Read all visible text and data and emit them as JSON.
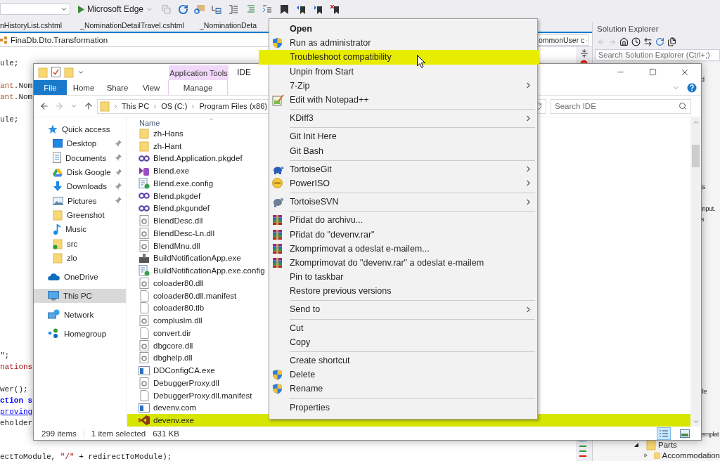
{
  "ide": {
    "toolbar": {
      "run_target": "Microsoft Edge"
    },
    "document_tabs": [
      "nHistoryList.cshtml",
      "_NominationDetailTravel.cshtml",
      "_NominationDeta"
    ],
    "nav_bar": {
      "type_path": "FinaDb.Dto.Transformation",
      "member": "ommonUser c"
    },
    "code_lines": [
      {
        "kind": "code",
        "tokens": [
          {
            "text": "ule;",
            "kind": "plain"
          }
        ]
      },
      {
        "kind": "blank"
      },
      {
        "kind": "code",
        "tokens": [
          {
            "text": "ant",
            "kind": "identifier"
          },
          {
            "text": ".Nom",
            "kind": "plain"
          }
        ]
      },
      {
        "kind": "code",
        "tokens": [
          {
            "text": "ant",
            "kind": "identifier"
          },
          {
            "text": ".Nom",
            "kind": "plain"
          }
        ]
      },
      {
        "kind": "blank"
      },
      {
        "kind": "code",
        "tokens": [
          {
            "text": "ule;",
            "kind": "plain"
          }
        ]
      },
      {
        "kind": "blank"
      },
      {
        "kind": "blank"
      },
      {
        "kind": "blank"
      },
      {
        "kind": "blank"
      },
      {
        "kind": "blank"
      },
      {
        "kind": "blank"
      },
      {
        "kind": "blank"
      },
      {
        "kind": "blank"
      },
      {
        "kind": "blank"
      },
      {
        "kind": "blank"
      },
      {
        "kind": "blank"
      },
      {
        "kind": "blank"
      },
      {
        "kind": "blank"
      },
      {
        "kind": "blank"
      },
      {
        "kind": "blank"
      },
      {
        "kind": "blank"
      },
      {
        "kind": "blank"
      },
      {
        "kind": "blank"
      },
      {
        "kind": "blank"
      },
      {
        "kind": "blank"
      },
      {
        "kind": "code",
        "tokens": [
          {
            "text": "\";",
            "kind": "plain"
          }
        ]
      },
      {
        "kind": "code",
        "tokens": [
          {
            "text": "nations",
            "kind": "string"
          }
        ]
      },
      {
        "kind": "blank"
      },
      {
        "kind": "code",
        "tokens": [
          {
            "text": "wer();",
            "kind": "plain"
          }
        ]
      },
      {
        "kind": "code",
        "tokens": [
          {
            "text": "ction s",
            "kind": "keyword"
          }
        ]
      },
      {
        "kind": "code",
        "tokens": [
          {
            "text": "proving",
            "kind": "link"
          }
        ]
      },
      {
        "kind": "code",
        "tokens": [
          {
            "text": "eholder",
            "kind": "plain"
          }
        ]
      },
      {
        "kind": "blank"
      },
      {
        "kind": "blank"
      },
      {
        "kind": "code",
        "tokens": [
          {
            "text": "ectToModule, ",
            "kind": "plain"
          },
          {
            "text": "\"/\"",
            "kind": "string"
          },
          {
            "text": " + redirectToModule);",
            "kind": "plain"
          }
        ]
      }
    ]
  },
  "solution_explorer": {
    "title": "Solution Explorer",
    "search": {
      "placeholder": "Search Solution Explorer (Ctrl+;)"
    },
    "rows": [
      {
        "kind": "fragment",
        "text": "d"
      },
      {
        "kind": "blank"
      },
      {
        "kind": "blank"
      },
      {
        "kind": "blank"
      },
      {
        "kind": "blank"
      },
      {
        "kind": "blank"
      },
      {
        "kind": "blank"
      },
      {
        "kind": "blank"
      },
      {
        "kind": "blank"
      },
      {
        "kind": "blank"
      },
      {
        "kind": "fragment",
        "text": "js"
      },
      {
        "kind": "blank"
      },
      {
        "kind": "fragment",
        "text": "input."
      },
      {
        "kind": "fragment",
        "text": "s"
      },
      {
        "kind": "blank"
      },
      {
        "kind": "blank"
      },
      {
        "kind": "blank"
      },
      {
        "kind": "blank"
      },
      {
        "kind": "blank"
      },
      {
        "kind": "blank"
      },
      {
        "kind": "blank"
      },
      {
        "kind": "blank"
      },
      {
        "kind": "blank"
      },
      {
        "kind": "blank"
      },
      {
        "kind": "blank"
      },
      {
        "kind": "blank"
      },
      {
        "kind": "blank"
      },
      {
        "kind": "blank"
      },
      {
        "kind": "blank"
      },
      {
        "kind": "fragment",
        "text": "ile"
      },
      {
        "kind": "blank"
      },
      {
        "kind": "blank"
      },
      {
        "kind": "blank"
      },
      {
        "kind": "fragment",
        "text": "emplat"
      },
      {
        "kind": "folder",
        "text": "Parts",
        "expanded": true,
        "children": [
          {
            "kind": "folder",
            "text": "Accommodation",
            "expanded": false
          }
        ]
      }
    ]
  },
  "explorer": {
    "context_tab_group": "Application Tools",
    "title": "IDE",
    "ribbon_tabs": [
      {
        "label": "File",
        "kind": "file"
      },
      {
        "label": "Home",
        "kind": "tab"
      },
      {
        "label": "Share",
        "kind": "tab"
      },
      {
        "label": "View",
        "kind": "tab"
      },
      {
        "label": "Manage",
        "kind": "context"
      }
    ],
    "address": [
      "This PC",
      "OS (C:)",
      "Program Files (x86)"
    ],
    "search": {
      "placeholder": "Search IDE"
    },
    "nav": [
      {
        "label": "Quick access",
        "kind": "quick-access",
        "selected": false,
        "children": [
          {
            "label": "Desktop",
            "kind": "desktop",
            "pinned": true,
            "selected": false
          },
          {
            "label": "Documents",
            "kind": "documents",
            "pinned": true,
            "selected": false
          },
          {
            "label": "Disk Google",
            "kind": "drive",
            "pinned": true,
            "selected": false
          },
          {
            "label": "Downloads",
            "kind": "downloads",
            "pinned": true,
            "selected": false
          },
          {
            "label": "Pictures",
            "kind": "pictures",
            "pinned": true,
            "selected": false
          },
          {
            "label": "Greenshot",
            "kind": "folder",
            "pinned": false,
            "selected": false
          },
          {
            "label": "Music",
            "kind": "music",
            "pinned": false,
            "selected": false
          },
          {
            "label": "src",
            "kind": "synced-folder",
            "pinned": false,
            "selected": false
          },
          {
            "label": "zlo",
            "kind": "folder",
            "pinned": false,
            "selected": false
          }
        ]
      },
      {
        "label": "OneDrive",
        "kind": "cloud",
        "selected": false
      },
      {
        "label": "This PC",
        "kind": "pc",
        "selected": true
      },
      {
        "label": "Network",
        "kind": "network",
        "selected": false
      },
      {
        "label": "Homegroup",
        "kind": "homegroup",
        "selected": false
      }
    ],
    "columns": [
      "Name"
    ],
    "files": [
      {
        "name": "zh-Hans",
        "kind": "folder",
        "selected": false
      },
      {
        "name": "zh-Hant",
        "kind": "folder",
        "selected": false
      },
      {
        "name": "Blend.Application.pkgdef",
        "kind": "package",
        "selected": false
      },
      {
        "name": "Blend.exe",
        "kind": "blend",
        "selected": false
      },
      {
        "name": "Blend.exe.config",
        "kind": "config",
        "selected": false
      },
      {
        "name": "Blend.pkgdef",
        "kind": "package",
        "selected": false
      },
      {
        "name": "Blend.pkgundef",
        "kind": "package",
        "selected": false
      },
      {
        "name": "BlendDesc.dll",
        "kind": "library",
        "selected": false
      },
      {
        "name": "BlendDesc-Ln.dll",
        "kind": "library",
        "selected": false
      },
      {
        "name": "BlendMnu.dll",
        "kind": "library",
        "selected": false
      },
      {
        "name": "BuildNotificationApp.exe",
        "kind": "build-app",
        "selected": false
      },
      {
        "name": "BuildNotificationApp.exe.config",
        "kind": "config",
        "selected": false
      },
      {
        "name": "coloader80.dll",
        "kind": "library",
        "selected": false
      },
      {
        "name": "coloader80.dll.manifest",
        "kind": "document",
        "selected": false
      },
      {
        "name": "coloader80.tlb",
        "kind": "document",
        "selected": false
      },
      {
        "name": "compluslm.dll",
        "kind": "library",
        "selected": false
      },
      {
        "name": "convert.dir",
        "kind": "document",
        "selected": false
      },
      {
        "name": "dbgcore.dll",
        "kind": "library",
        "selected": false
      },
      {
        "name": "dbghelp.dll",
        "kind": "library",
        "selected": false
      },
      {
        "name": "DDConfigCA.exe",
        "kind": "window-app",
        "selected": false
      },
      {
        "name": "DebuggerProxy.dll",
        "kind": "library",
        "selected": false
      },
      {
        "name": "DebuggerProxy.dll.manifest",
        "kind": "document",
        "selected": false
      },
      {
        "name": "devenv.com",
        "kind": "window-app",
        "selected": false
      },
      {
        "name": "devenv.exe",
        "kind": "vs-app",
        "selected": true
      }
    ],
    "status": {
      "count": "299 items",
      "selection": "1 item selected",
      "size": "631 KB"
    },
    "views": [
      {
        "kind": "details",
        "selected": true
      },
      {
        "kind": "tiles",
        "selected": false
      }
    ]
  },
  "context_menu": {
    "groups": [
      {
        "items": [
          {
            "label": "Open",
            "kind": "plain",
            "default": true,
            "submenu": false,
            "selected": false
          },
          {
            "label": "Run as administrator",
            "kind": "shield",
            "default": false,
            "submenu": false,
            "selected": false
          },
          {
            "label": "Troubleshoot compatibility",
            "kind": "plain",
            "default": false,
            "submenu": false,
            "selected": true
          },
          {
            "label": "Unpin from Start",
            "kind": "plain",
            "default": false,
            "submenu": false,
            "selected": false
          },
          {
            "label": "7-Zip",
            "kind": "plain",
            "default": false,
            "submenu": true,
            "selected": false
          },
          {
            "label": "Edit with Notepad++",
            "kind": "notepad",
            "default": false,
            "submenu": false,
            "selected": false
          }
        ]
      },
      {
        "items": [
          {
            "label": "KDiff3",
            "kind": "plain",
            "default": false,
            "submenu": true,
            "selected": false
          }
        ]
      },
      {
        "items": [
          {
            "label": "Git Init Here",
            "kind": "plain",
            "default": false,
            "submenu": false,
            "selected": false
          },
          {
            "label": "Git Bash",
            "kind": "plain",
            "default": false,
            "submenu": false,
            "selected": false
          }
        ]
      },
      {
        "items": [
          {
            "label": "TortoiseGit",
            "kind": "turtle-blue",
            "default": false,
            "submenu": true,
            "selected": false
          },
          {
            "label": "PowerISO",
            "kind": "disc",
            "default": false,
            "submenu": true,
            "selected": false
          }
        ]
      },
      {
        "items": [
          {
            "label": "TortoiseSVN",
            "kind": "turtle-gray",
            "default": false,
            "submenu": true,
            "selected": false
          }
        ]
      },
      {
        "items": [
          {
            "label": "Přidat do archivu...",
            "kind": "archive",
            "default": false,
            "submenu": false,
            "selected": false
          },
          {
            "label": "Přidat do \"devenv.rar\"",
            "kind": "archive",
            "default": false,
            "submenu": false,
            "selected": false
          },
          {
            "label": "Zkomprimovat a odeslat e-mailem...",
            "kind": "archive",
            "default": false,
            "submenu": false,
            "selected": false
          },
          {
            "label": "Zkomprimovat do \"devenv.rar\" a odeslat e-mailem",
            "kind": "archive",
            "default": false,
            "submenu": false,
            "selected": false
          },
          {
            "label": "Pin to taskbar",
            "kind": "plain",
            "default": false,
            "submenu": false,
            "selected": false
          },
          {
            "label": "Restore previous versions",
            "kind": "plain",
            "default": false,
            "submenu": false,
            "selected": false
          }
        ]
      },
      {
        "items": [
          {
            "label": "Send to",
            "kind": "plain",
            "default": false,
            "submenu": true,
            "selected": false
          }
        ]
      },
      {
        "items": [
          {
            "label": "Cut",
            "kind": "plain",
            "default": false,
            "submenu": false,
            "selected": false
          },
          {
            "label": "Copy",
            "kind": "plain",
            "default": false,
            "submenu": false,
            "selected": false
          }
        ]
      },
      {
        "items": [
          {
            "label": "Create shortcut",
            "kind": "plain",
            "default": false,
            "submenu": false,
            "selected": false
          },
          {
            "label": "Delete",
            "kind": "shield",
            "default": false,
            "submenu": false,
            "selected": false
          },
          {
            "label": "Rename",
            "kind": "shield",
            "default": false,
            "submenu": false,
            "selected": false
          }
        ]
      },
      {
        "items": [
          {
            "label": "Properties",
            "kind": "plain",
            "default": false,
            "submenu": false,
            "selected": false
          }
        ]
      }
    ]
  }
}
